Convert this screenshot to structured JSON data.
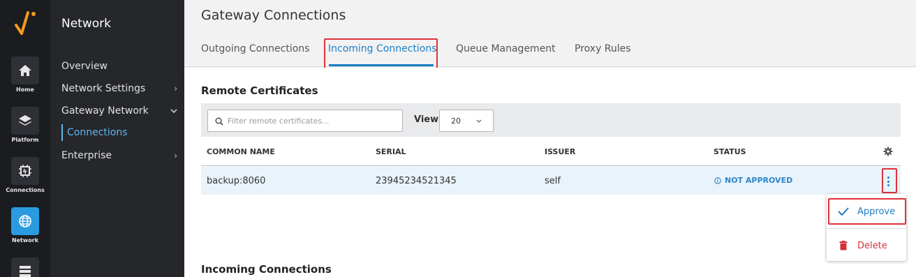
{
  "rail": {
    "items": [
      {
        "label": "Home",
        "icon": "home-icon"
      },
      {
        "label": "Platform",
        "icon": "layers-icon"
      },
      {
        "label": "Connections",
        "icon": "connections-icon"
      },
      {
        "label": "Network",
        "icon": "globe-icon",
        "active": true
      },
      {
        "label": "",
        "icon": "server-icon"
      }
    ]
  },
  "sidebar": {
    "title": "Network",
    "items": [
      {
        "label": "Overview"
      },
      {
        "label": "Network Settings",
        "chevron": "right"
      },
      {
        "label": "Gateway Network",
        "chevron": "down"
      },
      {
        "label": "Connections",
        "active": true
      },
      {
        "label": "Enterprise",
        "chevron": "right"
      }
    ]
  },
  "header": {
    "title": "Gateway Connections",
    "tabs": [
      {
        "label": "Outgoing Connections"
      },
      {
        "label": "Incoming Connections",
        "active": true
      },
      {
        "label": "Queue Management"
      },
      {
        "label": "Proxy Rules"
      }
    ]
  },
  "remote_certs": {
    "title": "Remote Certificates",
    "search_placeholder": "Filter remote certificates...",
    "view_label": "View",
    "view_value": "20",
    "columns": [
      "COMMON NAME",
      "SERIAL",
      "ISSUER",
      "STATUS"
    ],
    "rows": [
      {
        "common_name": "backup:8060",
        "serial": "23945234521345",
        "issuer": "self",
        "status": "NOT APPROVED"
      }
    ]
  },
  "row_menu": {
    "approve_label": "Approve",
    "delete_label": "Delete"
  },
  "incoming": {
    "title": "Incoming Connections"
  },
  "colors": {
    "accent": "#1b7fc4",
    "highlight": "#e0313a",
    "danger": "#d0313a",
    "brand_orange": "#f39a1e"
  }
}
